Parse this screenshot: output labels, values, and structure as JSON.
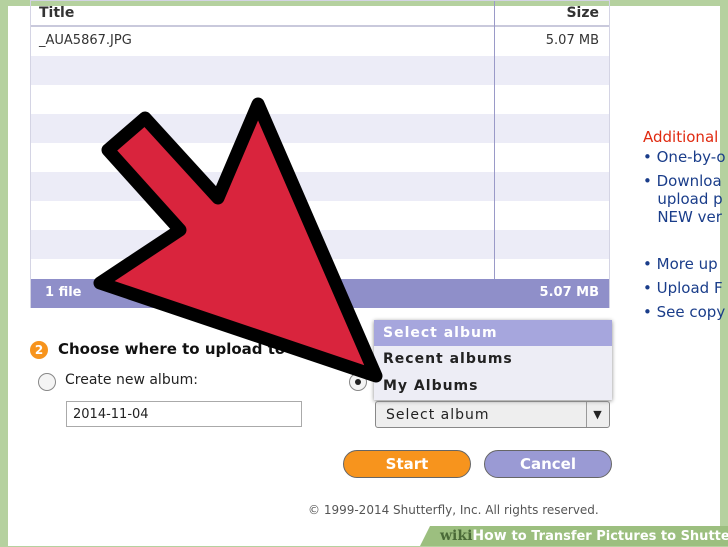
{
  "table": {
    "headers": {
      "title": "Title",
      "size": "Size"
    },
    "rows": [
      {
        "title": "_AUA5867.JPG",
        "size": "5.07 MB"
      }
    ],
    "footer": {
      "count": "1 file",
      "total": "5.07 MB"
    }
  },
  "sidebar": {
    "heading": "Additional",
    "links": [
      "One-by-o",
      "Downloa",
      "upload p",
      "NEW ver",
      "More up",
      "Upload F",
      "See copy"
    ]
  },
  "step": {
    "number": "2",
    "title": "Choose where to upload to"
  },
  "options": {
    "new_album_label": "Create new album:",
    "new_album_value": "2014-11-04"
  },
  "dropdown": {
    "selected": "Select album",
    "options": [
      "Select album",
      "Recent albums",
      "My Albums"
    ]
  },
  "buttons": {
    "start": "Start",
    "cancel": "Cancel"
  },
  "copyright": "© 1999-2014 Shutterfly, Inc. All rights reserved.",
  "watermark": {
    "wiki": "wiki",
    "how": "How",
    "title": "to Transfer Pictures to Shutterfly"
  },
  "colors": {
    "accent": "#f7941d",
    "bar": "#8f8fc9",
    "arrow": "#d9243d"
  }
}
